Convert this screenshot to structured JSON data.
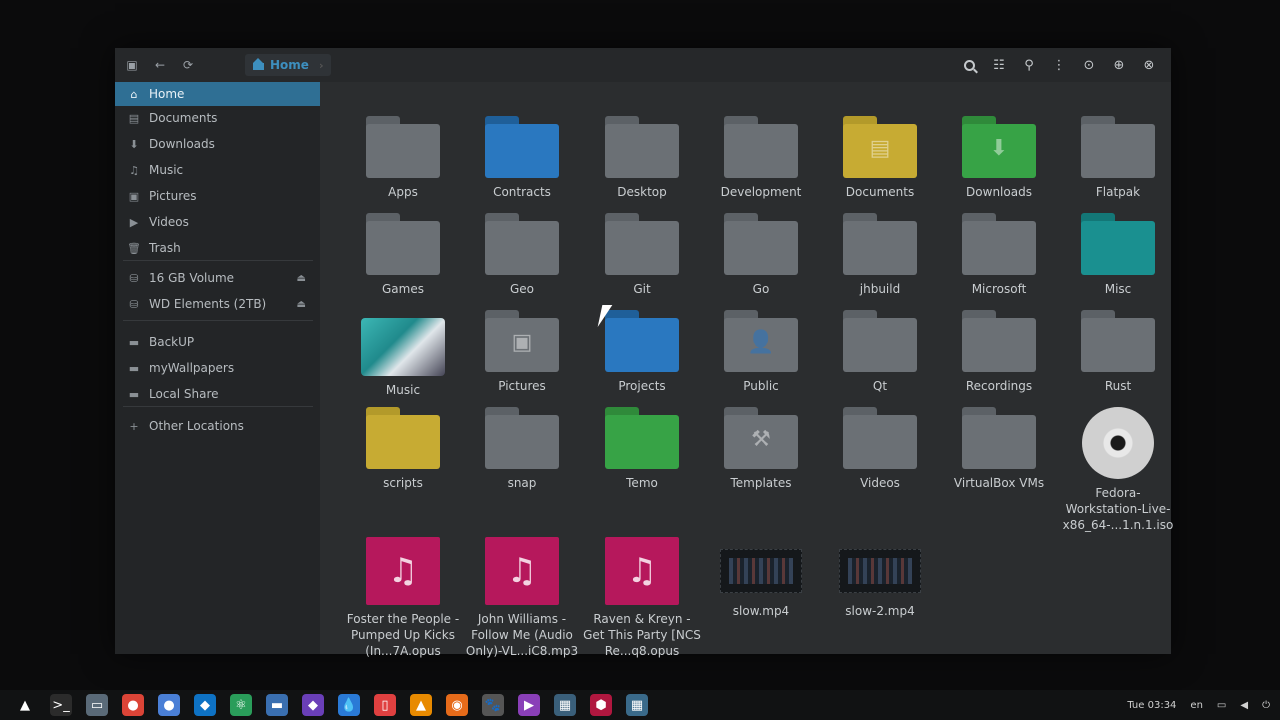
{
  "window": {
    "breadcrumb": "Home",
    "sidebar": [
      {
        "label": "Home",
        "icon": "home-icon",
        "active": true
      },
      {
        "label": "Documents",
        "icon": "document-icon"
      },
      {
        "label": "Downloads",
        "icon": "download-icon"
      },
      {
        "label": "Music",
        "icon": "music-icon"
      },
      {
        "label": "Pictures",
        "icon": "picture-icon"
      },
      {
        "label": "Videos",
        "icon": "video-icon"
      },
      {
        "label": "Trash",
        "icon": "trash-icon"
      },
      {
        "label": "16 GB Volume",
        "icon": "drive-icon",
        "eject": true
      },
      {
        "label": "WD Elements (2TB)",
        "icon": "drive-icon",
        "eject": true
      },
      {
        "label": "BackUP",
        "icon": "folder-icon"
      },
      {
        "label": "myWallpapers",
        "icon": "folder-icon"
      },
      {
        "label": "Local Share",
        "icon": "folder-icon"
      },
      {
        "label": "Other Locations",
        "icon": "plus-icon"
      }
    ],
    "items": [
      {
        "label": "Apps",
        "kind": "folder",
        "color": "gray"
      },
      {
        "label": "Contracts",
        "kind": "folder",
        "color": "blue"
      },
      {
        "label": "Desktop",
        "kind": "folder",
        "color": "gray"
      },
      {
        "label": "Development",
        "kind": "folder",
        "color": "gray"
      },
      {
        "label": "Documents",
        "kind": "folder",
        "color": "yellow"
      },
      {
        "label": "Downloads",
        "kind": "folder",
        "color": "green"
      },
      {
        "label": "Flatpak",
        "kind": "folder",
        "color": "gray"
      },
      {
        "label": "Games",
        "kind": "folder",
        "color": "gray"
      },
      {
        "label": "Geo",
        "kind": "folder",
        "color": "gray"
      },
      {
        "label": "Git",
        "kind": "folder",
        "color": "gray"
      },
      {
        "label": "Go",
        "kind": "folder",
        "color": "gray"
      },
      {
        "label": "jhbuild",
        "kind": "folder",
        "color": "gray"
      },
      {
        "label": "Microsoft",
        "kind": "folder",
        "color": "gray"
      },
      {
        "label": "Misc",
        "kind": "folder",
        "color": "teal"
      },
      {
        "label": "Music",
        "kind": "music-folder"
      },
      {
        "label": "Pictures",
        "kind": "folder",
        "color": "gray"
      },
      {
        "label": "Projects",
        "kind": "folder",
        "color": "blue"
      },
      {
        "label": "Public",
        "kind": "folder",
        "color": "gray"
      },
      {
        "label": "Qt",
        "kind": "folder",
        "color": "gray"
      },
      {
        "label": "Recordings",
        "kind": "folder",
        "color": "gray"
      },
      {
        "label": "Rust",
        "kind": "folder",
        "color": "gray"
      },
      {
        "label": "scripts",
        "kind": "folder",
        "color": "yellow"
      },
      {
        "label": "snap",
        "kind": "folder",
        "color": "gray"
      },
      {
        "label": "Temo",
        "kind": "folder",
        "color": "green"
      },
      {
        "label": "Templates",
        "kind": "folder",
        "color": "gray"
      },
      {
        "label": "Videos",
        "kind": "folder",
        "color": "gray"
      },
      {
        "label": "VirtualBox VMs",
        "kind": "folder",
        "color": "gray"
      },
      {
        "label": "Fedora-Workstation-Live-x86_64-...1.n.1.iso",
        "kind": "disc"
      },
      {
        "label": "Foster the People - Pumped Up Kicks (In...7A.opus",
        "kind": "audio"
      },
      {
        "label": "John Williams - Follow Me (Audio Only)-VL...iC8.mp3",
        "kind": "audio"
      },
      {
        "label": "Raven & Kreyn - Get This Party [NCS Re...q8.opus",
        "kind": "audio"
      },
      {
        "label": "slow.mp4",
        "kind": "video"
      },
      {
        "label": "slow-2.mp4",
        "kind": "video"
      }
    ]
  },
  "taskbar": {
    "clock": "Tue 03:34",
    "lang": "en",
    "apps": [
      "app-launcher-icon",
      "terminal-icon",
      "files-icon",
      "chrome-icon",
      "chromium-icon",
      "vscode-icon",
      "atom-icon",
      "gnome-software-icon",
      "tor-icon",
      "droplet-icon",
      "writer-icon",
      "vlc-icon",
      "blender-icon",
      "gimp-icon",
      "media-player-icon",
      "screenshot-icon",
      "hex-icon",
      "window-icon"
    ]
  }
}
